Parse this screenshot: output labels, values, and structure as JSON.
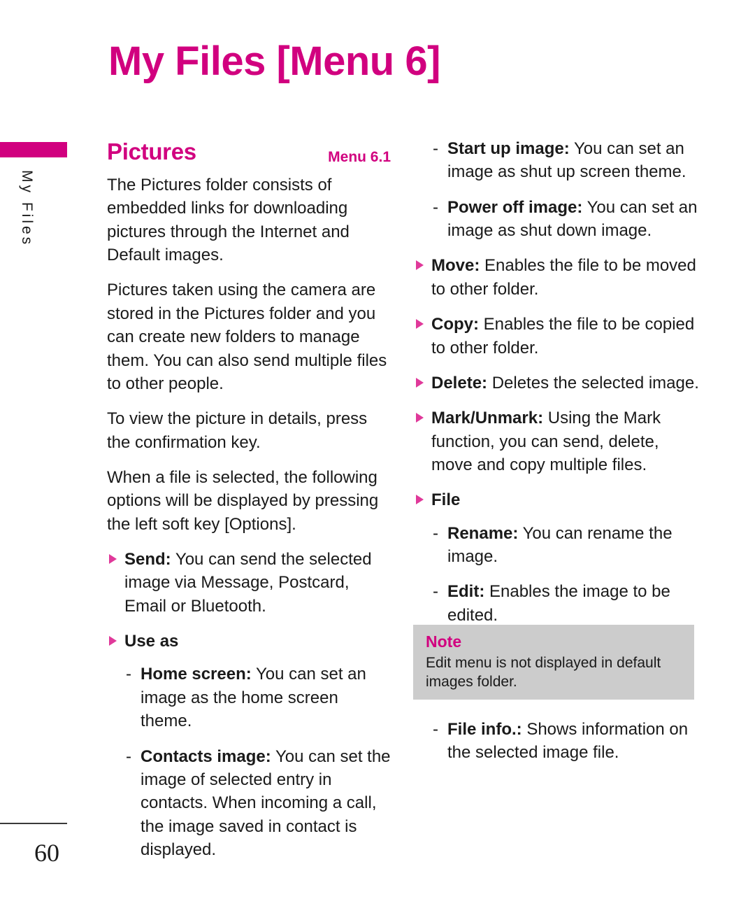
{
  "page": {
    "title": "My Files [Menu 6]",
    "side_tab_label": "My Files",
    "page_number": "60"
  },
  "section": {
    "title": "Pictures",
    "menu_ref": "Menu 6.1"
  },
  "left_column": {
    "paragraphs": [
      "The Pictures folder consists of embedded links for downloading pictures through the Internet and Default images.",
      "Pictures taken using the camera are stored in the Pictures folder and you can create new folders to manage them. You can also send multiple files to other people.",
      "To view the picture in details, press the confirmation key.",
      "When a file is selected, the following options will be displayed by pressing the left soft key [Options]."
    ],
    "items": [
      {
        "marker": "triangle",
        "term": "Send:",
        "desc": " You can send the selected image via Message, Postcard, Email or Bluetooth."
      },
      {
        "marker": "triangle",
        "term": "Use as",
        "desc": ""
      },
      {
        "marker": "dash",
        "dash": "-",
        "term": "Home screen:",
        "desc": " You can set an image as the home screen theme."
      },
      {
        "marker": "dash",
        "dash": "-",
        "term": "Contacts image:",
        "desc": " You can set the image of selected entry in contacts. When incoming a call, the image saved in contact is displayed."
      }
    ]
  },
  "right_column": {
    "items": [
      {
        "marker": "dash",
        "dash": "-",
        "term": "Start up image:",
        "desc": " You can set an image as shut up screen theme."
      },
      {
        "marker": "dash",
        "dash": "-",
        "term": "Power off image:",
        "desc": " You can set an image as shut down image."
      },
      {
        "marker": "triangle",
        "term": "Move:",
        "desc": " Enables the file to be moved to other folder."
      },
      {
        "marker": "triangle",
        "term": "Copy:",
        "desc": " Enables the file to be copied to other folder."
      },
      {
        "marker": "triangle",
        "term": "Delete:",
        "desc": " Deletes the selected image."
      },
      {
        "marker": "triangle",
        "term": "Mark/Unmark:",
        "desc": " Using the Mark function, you can send, delete, move and copy multiple files."
      },
      {
        "marker": "triangle",
        "term": "File",
        "desc": ""
      },
      {
        "marker": "dash",
        "dash": "-",
        "term": "Rename:",
        "desc": " You can rename the image."
      },
      {
        "marker": "dash",
        "dash": "-",
        "term": "Edit:",
        "desc": " Enables the image to be edited."
      }
    ],
    "post_note_items": [
      {
        "marker": "dash",
        "dash": "-",
        "term": "File info.:",
        "desc": " Shows information on the selected image file."
      }
    ]
  },
  "note": {
    "title": "Note",
    "body": "Edit menu is not displayed in default images folder."
  },
  "colors": {
    "accent": "#D1007F",
    "bullet": "#E0399A",
    "note_background": "#CCCCCC",
    "text": "#1a1a1a"
  }
}
